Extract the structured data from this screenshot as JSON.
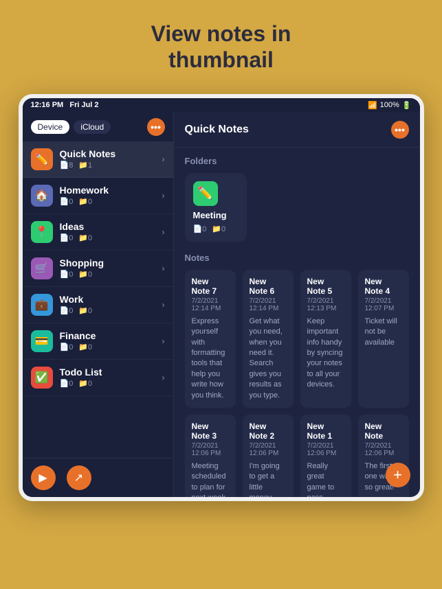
{
  "page": {
    "title": "View notes in\nthumbnail"
  },
  "statusBar": {
    "time": "12:16 PM",
    "date": "Fri Jul 2",
    "wifi": "100%"
  },
  "sidebar": {
    "tabs": [
      "Device",
      "iCloud"
    ],
    "activeTab": "Device",
    "items": [
      {
        "id": "quick-notes",
        "name": "Quick Notes",
        "icon": "✏️",
        "color": "#E8712A",
        "notes": 8,
        "folders": 1,
        "active": true
      },
      {
        "id": "homework",
        "name": "Homework",
        "icon": "🏠",
        "color": "#5B6AB5",
        "notes": 0,
        "folders": 0
      },
      {
        "id": "ideas",
        "name": "Ideas",
        "icon": "📍",
        "color": "#2ECC71",
        "notes": 0,
        "folders": 0
      },
      {
        "id": "shopping",
        "name": "Shopping",
        "icon": "🛒",
        "color": "#9B59B6",
        "notes": 0,
        "folders": 0
      },
      {
        "id": "work",
        "name": "Work",
        "icon": "💼",
        "color": "#3498DB",
        "notes": 0,
        "folders": 0
      },
      {
        "id": "finance",
        "name": "Finance",
        "icon": "💳",
        "color": "#1ABC9C",
        "notes": 0,
        "folders": 0
      },
      {
        "id": "todo",
        "name": "Todo List",
        "icon": "✅",
        "color": "#E74C3C",
        "notes": 0,
        "folders": 0
      }
    ],
    "bottomButtons": [
      "▶",
      "↗"
    ]
  },
  "mainPanel": {
    "title": "Quick Notes",
    "foldersLabel": "Folders",
    "folders": [
      {
        "name": "Meeting",
        "icon": "✏️",
        "color": "#2ECC71",
        "notes": 0,
        "folders": 0
      }
    ],
    "notesLabel": "Notes",
    "notes": [
      {
        "title": "New Note 7",
        "date": "7/2/2021 12:14 PM",
        "body": "Express yourself with formatting tools that help you write how you think."
      },
      {
        "title": "New Note 6",
        "date": "7/2/2021 12:14 PM",
        "body": "Get what you need, when you need it. Search gives you results as you type."
      },
      {
        "title": "New Note 5",
        "date": "7/2/2021 12:13 PM",
        "body": "Keep important info handy by syncing your notes to all your devices."
      },
      {
        "title": "New Note 4",
        "date": "7/2/2021 12:07 PM",
        "body": "Ticket will not be available"
      },
      {
        "title": "New Note 3",
        "date": "7/2/2021 12:06 PM",
        "body": "Meeting scheduled to plan for next week project."
      },
      {
        "title": "New Note 2",
        "date": "7/2/2021 12:06 PM",
        "body": "I'm going to get a little money"
      },
      {
        "title": "New Note 1",
        "date": "7/2/2021 12:06 PM",
        "body": "Really great game to pass"
      },
      {
        "title": "New Note",
        "date": "7/2/2021 12:06 PM",
        "body": "The first one was so great!"
      }
    ]
  }
}
